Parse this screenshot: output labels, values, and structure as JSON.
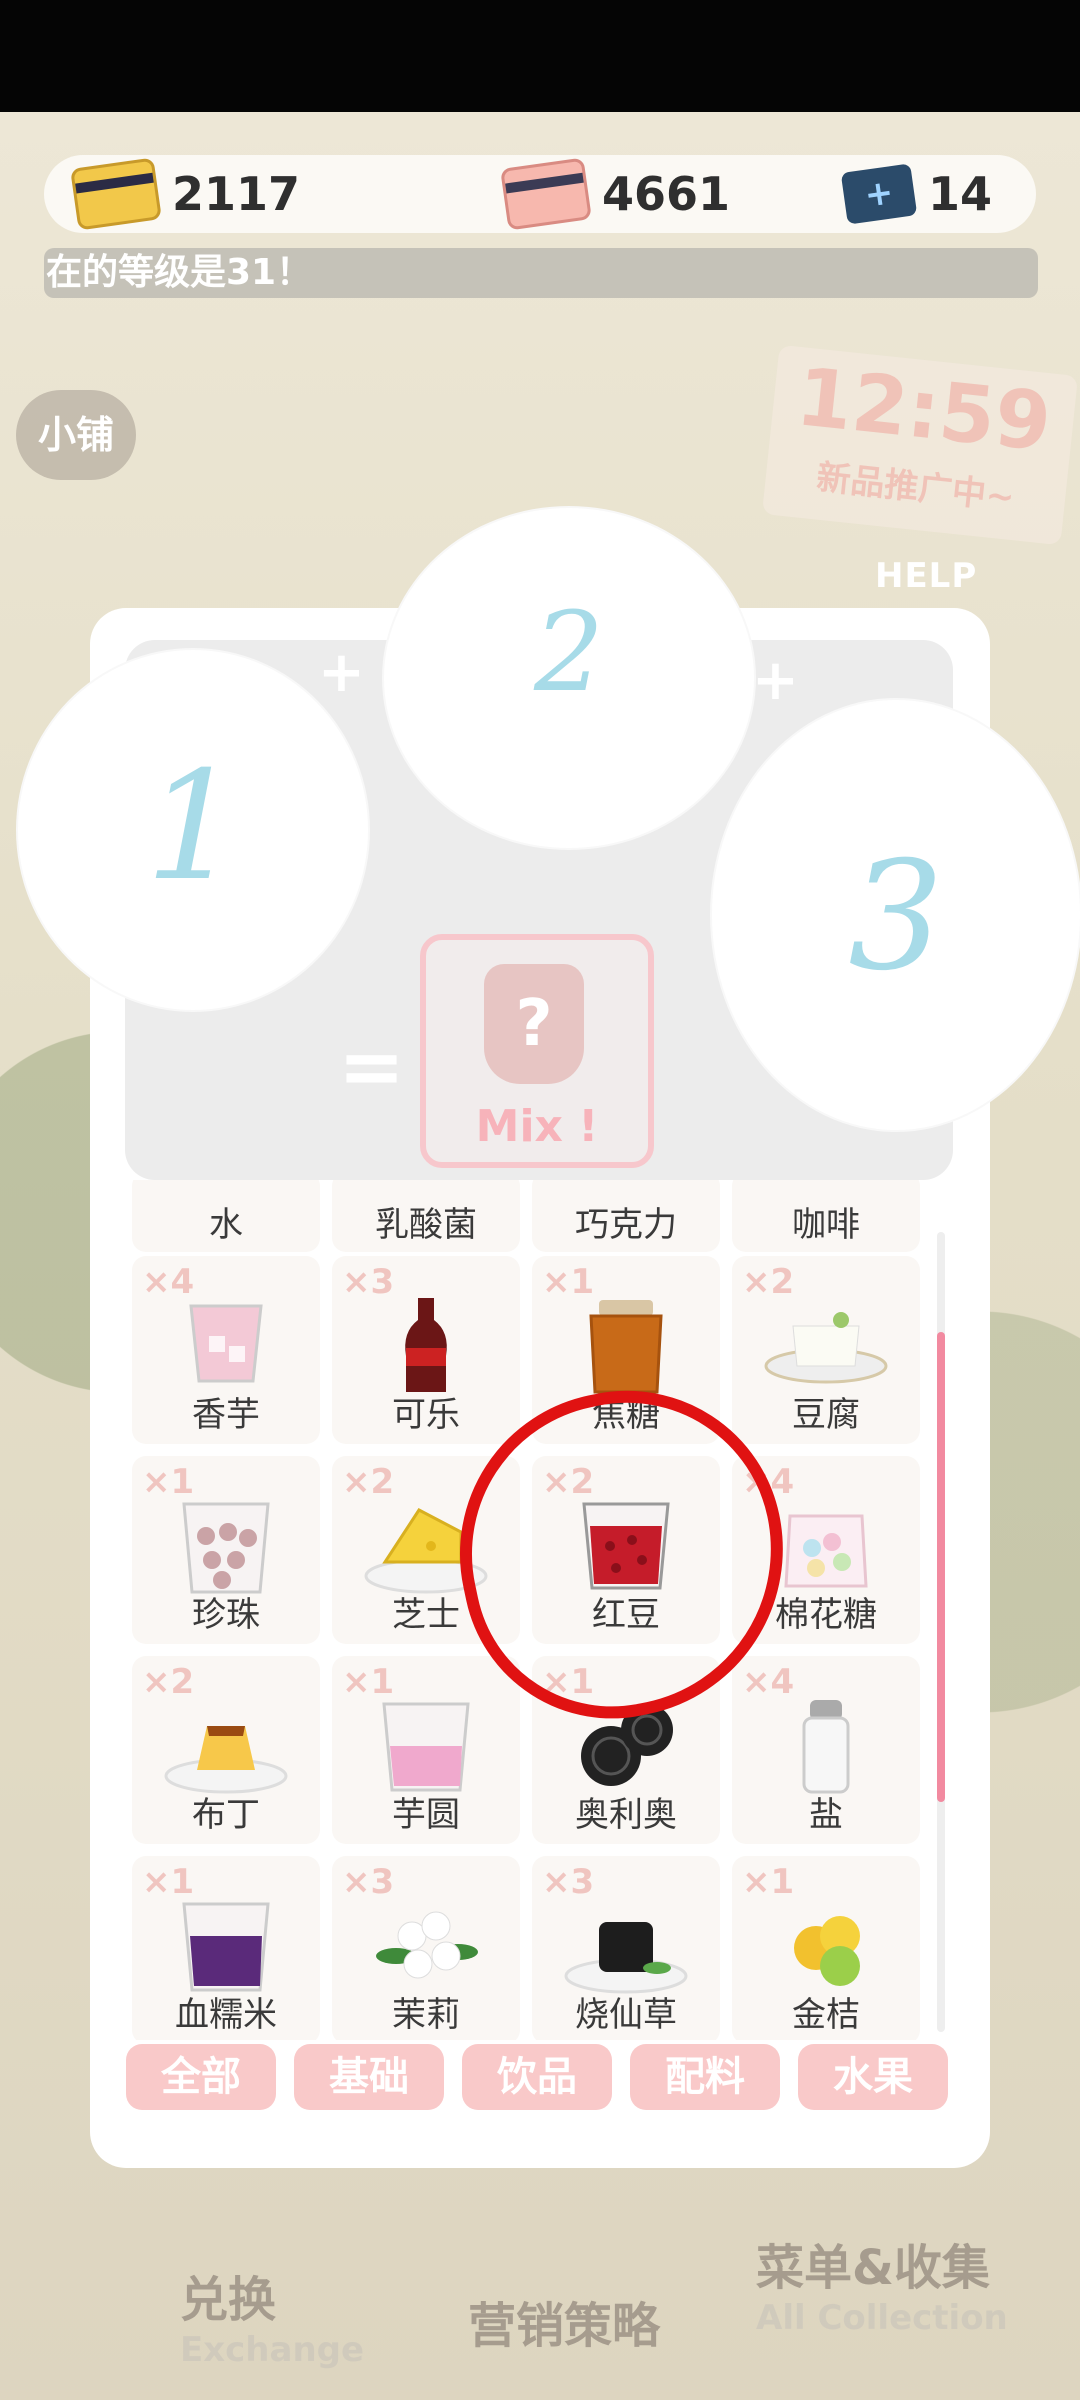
{
  "currency": {
    "gold_card": "2117",
    "pink_card": "4661",
    "ticket": "14"
  },
  "marquee_text": "在的等级是31！",
  "shop_tag": "小铺",
  "promo": {
    "time": "12:59",
    "sub": "新品推广中~"
  },
  "help_label": "HELP",
  "mixer": {
    "slot1": "1",
    "slot2": "2",
    "slot3": "3",
    "plus": "+",
    "equals": "=",
    "result_icon": "?",
    "result_label": "Mix !"
  },
  "ingredients_partial_row": [
    "水",
    "乳酸菌",
    "巧克力",
    "咖啡"
  ],
  "ingredients": [
    {
      "count": "×4",
      "name": "香芋",
      "icon": "taro-cup"
    },
    {
      "count": "×3",
      "name": "可乐",
      "icon": "cola-bottle"
    },
    {
      "count": "×1",
      "name": "焦糖",
      "icon": "caramel-jar"
    },
    {
      "count": "×2",
      "name": "豆腐",
      "icon": "tofu"
    },
    {
      "count": "×1",
      "name": "珍珠",
      "icon": "pearl-cup"
    },
    {
      "count": "×2",
      "name": "芝士",
      "icon": "cheese"
    },
    {
      "count": "×2",
      "name": "红豆",
      "icon": "red-bean-cup"
    },
    {
      "count": "×4",
      "name": "棉花糖",
      "icon": "marshmallow-bag"
    },
    {
      "count": "×2",
      "name": "布丁",
      "icon": "pudding"
    },
    {
      "count": "×1",
      "name": "芋圆",
      "icon": "taro-ball-cup"
    },
    {
      "count": "×1",
      "name": "奥利奥",
      "icon": "oreo"
    },
    {
      "count": "×4",
      "name": "盐",
      "icon": "salt-shaker"
    },
    {
      "count": "×1",
      "name": "血糯米",
      "icon": "black-rice-cup"
    },
    {
      "count": "×3",
      "name": "茉莉",
      "icon": "jasmine"
    },
    {
      "count": "×3",
      "name": "烧仙草",
      "icon": "grass-jelly"
    },
    {
      "count": "×1",
      "name": "金桔",
      "icon": "kumquat"
    }
  ],
  "tabs": [
    "全部",
    "基础",
    "饮品",
    "配料",
    "水果"
  ],
  "bottom_nav": {
    "exchange": "兑换",
    "exchange_en": "Exchange",
    "marketing": "营销策略",
    "menu": "菜单&收集",
    "menu_en": "All Collection"
  },
  "colors": {
    "accent_pink": "#f9c9c9",
    "scroll_thumb": "#f28aa0",
    "annotation_red": "#e01212",
    "number_blue": "#a7dbe8"
  }
}
